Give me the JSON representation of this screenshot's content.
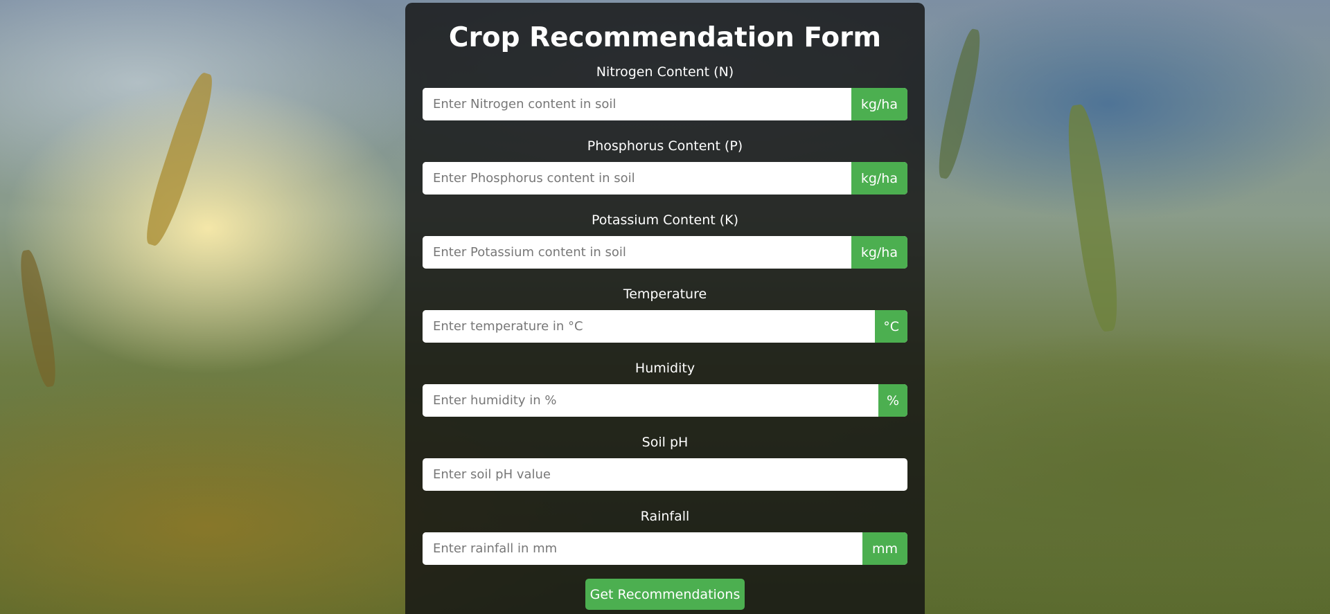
{
  "form": {
    "title": "Crop Recommendation Form",
    "fields": [
      {
        "label": "Nitrogen Content (N)",
        "placeholder": "Enter Nitrogen content in soil",
        "unit": "kg/ha"
      },
      {
        "label": "Phosphorus Content (P)",
        "placeholder": "Enter Phosphorus content in soil",
        "unit": "kg/ha"
      },
      {
        "label": "Potassium Content (K)",
        "placeholder": "Enter Potassium content in soil",
        "unit": "kg/ha"
      },
      {
        "label": "Temperature",
        "placeholder": "Enter temperature in °C",
        "unit": "°C"
      },
      {
        "label": "Humidity",
        "placeholder": "Enter humidity in %",
        "unit": "%"
      },
      {
        "label": "Soil pH",
        "placeholder": "Enter soil pH value",
        "unit": ""
      },
      {
        "label": "Rainfall",
        "placeholder": "Enter rainfall in mm",
        "unit": "mm"
      }
    ],
    "submit_label": "Get Recommendations"
  },
  "colors": {
    "accent": "#4caf50",
    "card_background": "#141414",
    "text": "#ffffff"
  }
}
